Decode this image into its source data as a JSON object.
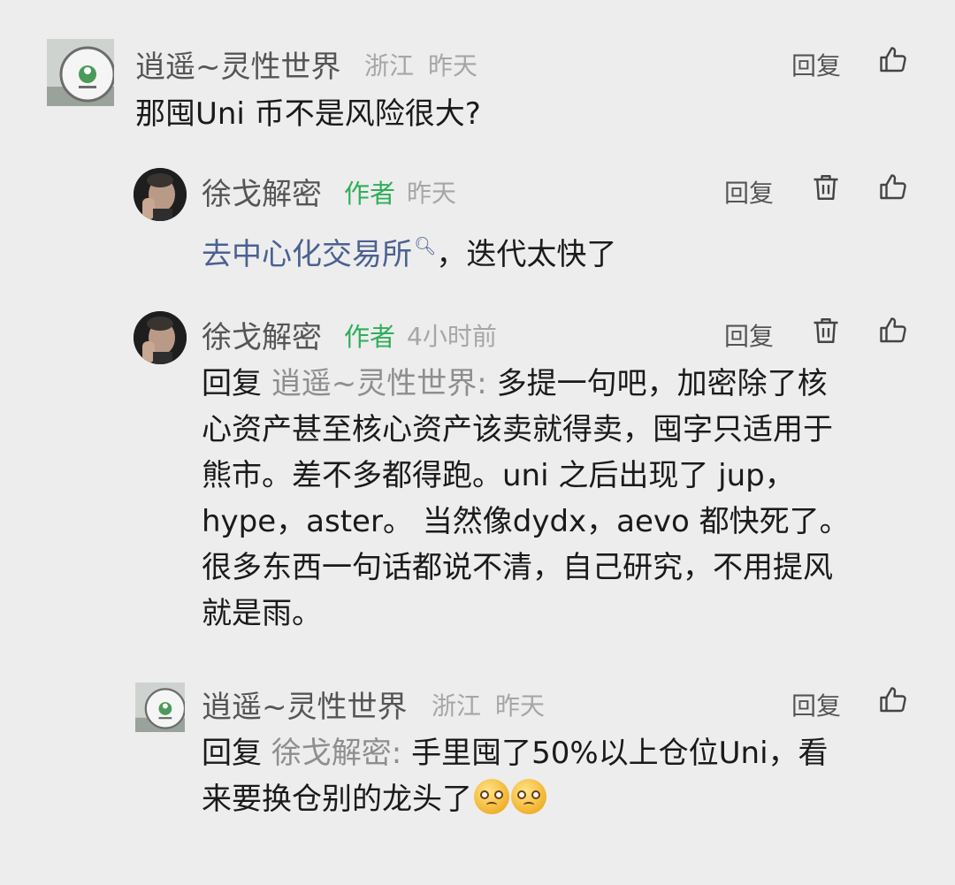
{
  "comments": [
    {
      "user": "逍遥~灵性世界",
      "location": "浙江",
      "time": "昨天",
      "reply_label": "回复",
      "text": "那囤Uni 币不是风险很大?"
    },
    {
      "user": "徐戈解密",
      "badge": "作者",
      "time": "昨天",
      "reply_label": "回复",
      "link_text": "去中心化交易所",
      "text_after_link": "，迭代太快了"
    },
    {
      "user": "徐戈解密",
      "badge": "作者",
      "time": "4小时前",
      "reply_label": "回复",
      "reply_prefix": "回复",
      "reply_target": "逍遥~灵性世界:",
      "lines": [
        "多提一句吧，加密除了核",
        "心资产甚至核心资产该卖就得卖，囤字只适用于",
        "熊市。差不多都得跑。uni 之后出现了 jup，",
        "hype，aster。 当然像dydx，aevo 都快死了。",
        "很多东西一句话都说不清，自己研究，不用提风",
        "就是雨。"
      ]
    },
    {
      "user": "逍遥~灵性世界",
      "location": "浙江",
      "time": "昨天",
      "reply_label": "回复",
      "reply_prefix": "回复",
      "reply_target": "徐戈解密:",
      "lines": [
        "手里囤了50%以上仓位Uni，看",
        "来要换仓别的龙头了"
      ]
    }
  ],
  "icons": {
    "like": "thumbs-up-icon",
    "delete": "trash-icon",
    "search": "search-icon",
    "emoji": "woozy-face-emoji"
  },
  "colors": {
    "background": "#ededed",
    "author_badge": "#2fae5a",
    "link": "#4a6191",
    "meta": "#a6a6a6"
  }
}
